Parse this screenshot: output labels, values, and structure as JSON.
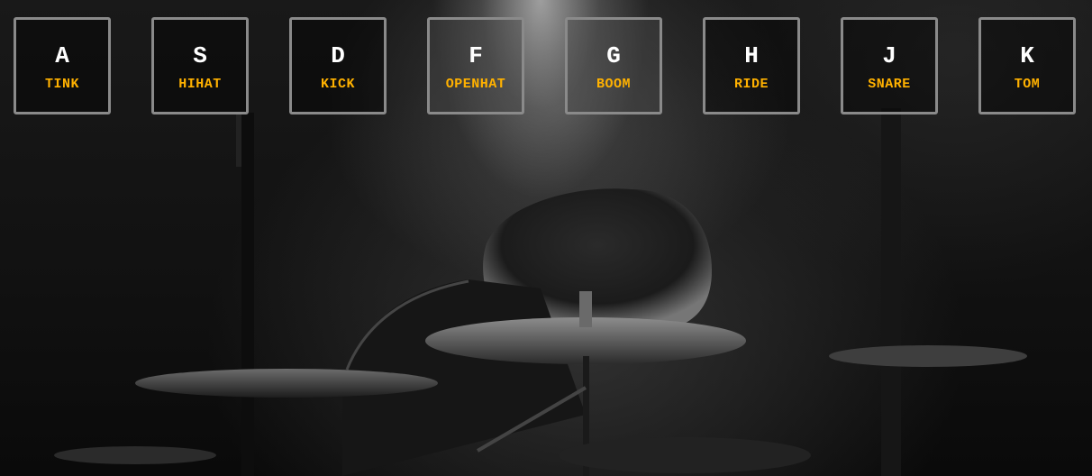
{
  "keys": [
    {
      "key": "A",
      "sound": "TINK"
    },
    {
      "key": "S",
      "sound": "HIHAT"
    },
    {
      "key": "D",
      "sound": "KICK"
    },
    {
      "key": "F",
      "sound": "OPENHAT"
    },
    {
      "key": "G",
      "sound": "BOOM"
    },
    {
      "key": "H",
      "sound": "RIDE"
    },
    {
      "key": "J",
      "sound": "SNARE"
    },
    {
      "key": "K",
      "sound": "TOM"
    }
  ],
  "colors": {
    "key_letter": "#ffffff",
    "sound_label": "#ffb100",
    "key_border": "#8a8a8a"
  }
}
